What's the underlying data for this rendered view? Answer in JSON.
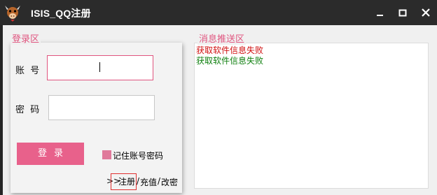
{
  "window": {
    "title": "ISIS_QQ注册",
    "icon": "cow-head-icon",
    "controls": [
      "minimize-icon",
      "maximize-icon",
      "close-icon"
    ]
  },
  "login": {
    "group_label": "登录区",
    "account_label": "账  号",
    "account_value": "",
    "password_label": "密  码",
    "password_value": "",
    "login_button": "登录",
    "remember_label": "记住账号密码",
    "remember_checked": false,
    "links": {
      "arrow": ">>",
      "register": "注册",
      "separator": "/",
      "recharge": "充值",
      "change_password": "改密"
    }
  },
  "messages": {
    "group_label": "消息推送区",
    "lines": [
      {
        "text": "获取软件信息失败",
        "color": "#d01010"
      },
      {
        "text": "获取软件信息失败",
        "color": "#108010"
      }
    ]
  },
  "colors": {
    "accent": "#e8618b",
    "titlebar": "#2b2b2b",
    "error_text": "#d01010",
    "ok_text": "#108010"
  }
}
